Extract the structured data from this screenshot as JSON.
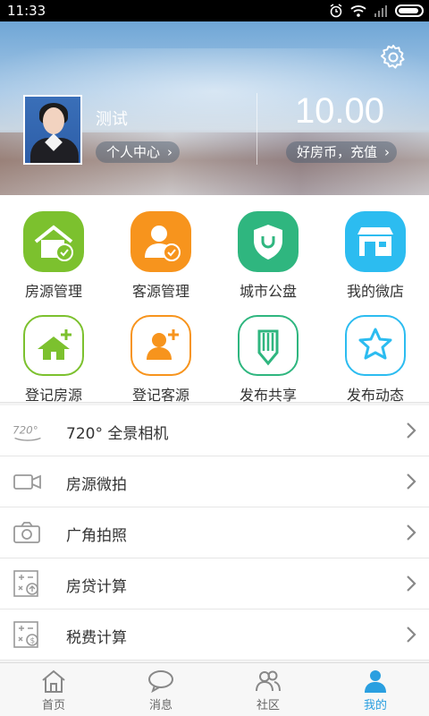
{
  "status_bar": {
    "time": "11:33"
  },
  "profile": {
    "name": "测试",
    "center_link": "个人中心",
    "coins": "10.00",
    "recharge_link": "好房币，充值"
  },
  "grid": [
    {
      "label": "房源管理",
      "icon": "house-check-icon"
    },
    {
      "label": "客源管理",
      "icon": "person-check-icon"
    },
    {
      "label": "城市公盘",
      "icon": "shield-icon"
    },
    {
      "label": "我的微店",
      "icon": "shop-icon"
    },
    {
      "label": "登记房源",
      "icon": "house-plus-icon"
    },
    {
      "label": "登记客源",
      "icon": "person-plus-icon"
    },
    {
      "label": "发布共享",
      "icon": "pencil-icon"
    },
    {
      "label": "发布动态",
      "icon": "star-icon"
    }
  ],
  "list": [
    {
      "label": "720°  全景相机",
      "icon_text": "720°",
      "icon": "panorama-icon"
    },
    {
      "label": "房源微拍",
      "icon": "video-camera-icon"
    },
    {
      "label": "广角拍照",
      "icon": "camera-icon"
    },
    {
      "label": "房贷计算",
      "icon": "calculator-icon"
    },
    {
      "label": "税费计算",
      "icon": "tax-calculator-icon"
    }
  ],
  "tabs": [
    {
      "label": "首页",
      "icon": "home-icon"
    },
    {
      "label": "消息",
      "icon": "chat-icon"
    },
    {
      "label": "社区",
      "icon": "community-icon"
    },
    {
      "label": "我的",
      "icon": "user-icon",
      "active": true
    }
  ],
  "colors": {
    "green": "#7cc12e",
    "orange": "#f7941d",
    "teal": "#2fb67f",
    "blue": "#2cbcf0",
    "active_tab": "#2a9fe0"
  }
}
